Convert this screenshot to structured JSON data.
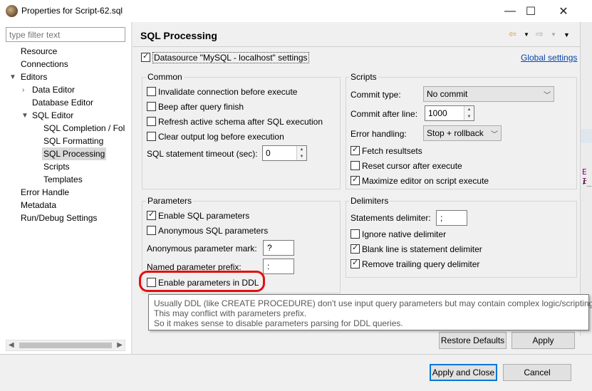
{
  "window": {
    "title": "Properties for Script-62.sql",
    "minimize": "—",
    "maximize": "☐",
    "close": "✕"
  },
  "filter": {
    "placeholder": "type filter text"
  },
  "tree": {
    "resource": "Resource",
    "connections": "Connections",
    "editors": "Editors",
    "data_editor": "Data Editor",
    "database_editor": "Database Editor",
    "sql_editor": "SQL Editor",
    "sql_completion": "SQL Completion / Fol",
    "sql_formatting": "SQL Formatting",
    "sql_processing": "SQL Processing",
    "scripts": "Scripts",
    "templates": "Templates",
    "error_handle": "Error Handle",
    "metadata": "Metadata",
    "run_debug": "Run/Debug Settings"
  },
  "page": {
    "title": "SQL Processing",
    "datasource_settings": "Datasource \"MySQL - localhost\" settings",
    "global_settings": "Global settings"
  },
  "common": {
    "title": "Common",
    "invalidate": "Invalidate connection before execute",
    "beep": "Beep after query finish",
    "refresh": "Refresh active schema after SQL execution",
    "clear_log": "Clear output log before execution",
    "timeout_label": "SQL statement timeout (sec):",
    "timeout_value": "0"
  },
  "scripts": {
    "title": "Scripts",
    "commit_type_label": "Commit type:",
    "commit_type_value": "No commit",
    "commit_after_label": "Commit after line:",
    "commit_after_value": "1000",
    "error_handling_label": "Error handling:",
    "error_handling_value": "Stop + rollback",
    "fetch_resultsets": "Fetch resultsets",
    "reset_cursor": "Reset cursor after execute",
    "maximize_editor": "Maximize editor on script execute"
  },
  "parameters": {
    "title": "Parameters",
    "enable_sql_params": "Enable SQL parameters",
    "anonymous_params": "Anonymous SQL parameters",
    "anon_mark_label": "Anonymous parameter mark:",
    "anon_mark_value": "?",
    "named_prefix_label": "Named parameter prefix:",
    "named_prefix_value": ":",
    "enable_ddl": "Enable parameters in DDL"
  },
  "delimiters": {
    "title": "Delimiters",
    "statements_label": "Statements delimiter:",
    "statements_value": ";",
    "ignore_native": "Ignore native delimiter",
    "blank_line": "Blank line is statement delimiter",
    "remove_trailing": "Remove trailing query delimiter"
  },
  "tooltip": {
    "line1": "Usually DDL (like CREATE PROCEDURE) don't use input query parameters but may contain complex logic/scripting.",
    "line2": "This may conflict with parameters prefix.",
    "line3": "So it makes sense to disable parameters parsing for DDL queries."
  },
  "buttons": {
    "restore_defaults": "Restore Defaults",
    "apply": "Apply",
    "apply_and_close": "Apply and Close",
    "cancel": "Cancel"
  },
  "colors": {
    "highlight_ring": "#e10f0f",
    "link": "#0645ad",
    "nav_arrow": "#d4a02a"
  }
}
